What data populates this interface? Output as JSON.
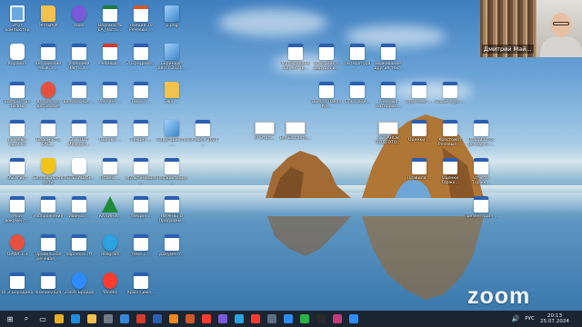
{
  "desktop_icons": [
    {
      "label": "Этот компьютер",
      "kind": "pc",
      "col": 0,
      "row": 0
    },
    {
      "label": "ЯРЛЫКИ",
      "kind": "folder",
      "col": 1,
      "row": 0
    },
    {
      "label": "Viber",
      "kind": "purple",
      "col": 2,
      "row": 0
    },
    {
      "label": "Ведомость ЕА_Часть...",
      "kind": "xls",
      "col": 3,
      "row": 0
    },
    {
      "label": "Лекция 10 Речевые ...",
      "kind": "ppt",
      "col": 4,
      "row": 0
    },
    {
      "label": "1.png",
      "kind": "img",
      "col": 5,
      "row": 0
    },
    {
      "label": "Корзина",
      "kind": "app",
      "col": 0,
      "row": 1
    },
    {
      "label": "английский язык 3 ...",
      "kind": "doc",
      "col": 1,
      "row": 1
    },
    {
      "label": "учебники Часть 3 ...",
      "kind": "doc",
      "col": 2,
      "row": 1
    },
    {
      "label": "Учебный ...",
      "kind": "pdf",
      "col": 3,
      "row": 1
    },
    {
      "label": "202pl-Дним...",
      "kind": "doc",
      "col": 4,
      "row": 1
    },
    {
      "label": "Скриншот 08.07.2024...",
      "kind": "img",
      "col": 5,
      "row": 1
    },
    {
      "label": "Восприятие письма",
      "kind": "doc",
      "col": 0,
      "row": 2
    },
    {
      "label": "депрессия депрессия",
      "kind": "red",
      "col": 1,
      "row": 2
    },
    {
      "label": "Визуальные ...",
      "kind": "doc",
      "col": 2,
      "row": 2
    },
    {
      "label": "Рейтинг ...",
      "kind": "doc",
      "col": 3,
      "row": 2
    },
    {
      "label": "Тема 2 ...",
      "kind": "doc",
      "col": 4,
      "row": 2
    },
    {
      "label": "Эко ...",
      "kind": "folder",
      "col": 5,
      "row": 2
    },
    {
      "label": "речевые ошибки",
      "kind": "doc",
      "col": 0,
      "row": 3
    },
    {
      "label": "Ведомость ЕАЕ_..",
      "kind": "doc",
      "col": 1,
      "row": 3
    },
    {
      "label": "ВС 2024 Информ...",
      "kind": "doc",
      "col": 2,
      "row": 3
    },
    {
      "label": "Оценки ...",
      "kind": "doc",
      "col": 3,
      "row": 3
    },
    {
      "label": "Лекция ...",
      "kind": "doc",
      "col": 4,
      "row": 3
    },
    {
      "label": "Навигация по ...",
      "kind": "img",
      "col": 5,
      "row": 3
    },
    {
      "label": "19 июля 2024 ...",
      "kind": "doc",
      "col": 6,
      "row": 3
    },
    {
      "label": "BSE-лист",
      "kind": "doc",
      "col": 0,
      "row": 4
    },
    {
      "label": "Безопасность сети",
      "kind": "shield",
      "col": 1,
      "row": 4
    },
    {
      "label": "РЕПЕТИЦИЯ...",
      "kind": "app",
      "col": 2,
      "row": 4
    },
    {
      "label": "Планы ...",
      "kind": "doc",
      "col": 3,
      "row": 4
    },
    {
      "label": "Мультимедиа ...",
      "kind": "doc",
      "col": 4,
      "row": 4
    },
    {
      "label": "Нафаризация ...",
      "kind": "doc",
      "col": 5,
      "row": 4
    },
    {
      "label": "Мой документ...",
      "kind": "doc",
      "col": 0,
      "row": 5
    },
    {
      "label": "изображения",
      "kind": "doc",
      "col": 1,
      "row": 5
    },
    {
      "label": "Иванов ...",
      "kind": "doc",
      "col": 2,
      "row": 5
    },
    {
      "label": "КАЛИНИ...",
      "kind": "tree",
      "col": 3,
      "row": 5
    },
    {
      "label": "Лекция ...",
      "kind": "doc",
      "col": 4,
      "row": 5
    },
    {
      "label": "НИЖНЕГО Программ...",
      "kind": "doc",
      "col": 5,
      "row": 5
    },
    {
      "label": "ОРФА 1-3",
      "kind": "red",
      "col": 0,
      "row": 6
    },
    {
      "label": "Правильная речевая ...",
      "kind": "doc",
      "col": 1,
      "row": 6
    },
    {
      "label": "sopheuss.rtf",
      "kind": "doc",
      "col": 2,
      "row": 6
    },
    {
      "label": "Telegram",
      "kind": "tg",
      "col": 3,
      "row": 6
    },
    {
      "label": "Тема 2 ...",
      "kind": "doc",
      "col": 4,
      "row": 6
    },
    {
      "label": "Документ...",
      "kind": "doc",
      "col": 5,
      "row": 6
    },
    {
      "label": "ОГЭ Бородина",
      "kind": "doc",
      "col": 0,
      "row": 7
    },
    {
      "label": "знание2024",
      "kind": "doc",
      "col": 1,
      "row": 7
    },
    {
      "label": "Zoom Бродов",
      "kind": "zoom",
      "col": 2,
      "row": 7
    },
    {
      "label": "Yandex",
      "kind": "ya",
      "col": 3,
      "row": 7
    },
    {
      "label": "Хрма Сима...",
      "kind": "doc",
      "col": 4,
      "row": 7
    },
    {
      "label": "Мутафудине директ ф...",
      "kind": "doc",
      "col": 9,
      "row": 1
    },
    {
      "label": "описание о дерудоли...",
      "kind": "doc",
      "col": 10,
      "row": 1
    },
    {
      "label": "Литература",
      "kind": "doc",
      "col": 11,
      "row": 1
    },
    {
      "label": "Выживание другие тек...",
      "kind": "doc",
      "col": 12,
      "row": 1
    },
    {
      "label": "Школа Павла Ко...",
      "kind": "doc",
      "col": 10,
      "row": 2
    },
    {
      "label": "Ольховой...",
      "kind": "doc",
      "col": 11,
      "row": 2
    },
    {
      "label": "Учебный материал...",
      "kind": "doc",
      "col": 12,
      "row": 2
    },
    {
      "label": "Фрагмент ...",
      "kind": "doc",
      "col": 13,
      "row": 2
    },
    {
      "label": "Пасхи курс ...",
      "kind": "doc",
      "col": 14,
      "row": 2
    },
    {
      "label": "IV Этап...",
      "kind": "slide",
      "col": 8,
      "row": 3
    },
    {
      "label": "ВМ Бюллете...",
      "kind": "slide",
      "col": 9,
      "row": 3
    },
    {
      "label": "5 ЭТАПОВ ПОДГОТО...",
      "kind": "slide",
      "col": 12,
      "row": 3
    },
    {
      "label": "Оценки ...",
      "kind": "doc",
      "col": 13,
      "row": 3
    },
    {
      "label": "Хрестомат Речевые ...",
      "kind": "doc",
      "col": 14,
      "row": 3
    },
    {
      "label": "Разработка речевого ...",
      "kind": "doc",
      "col": 15,
      "row": 3
    },
    {
      "label": "Правила ...",
      "kind": "doc",
      "col": 13,
      "row": 4
    },
    {
      "label": "Оценки Торжк...",
      "kind": "doc",
      "col": 14,
      "row": 4
    },
    {
      "label": "Отчеты Торжк...",
      "kind": "doc",
      "col": 15,
      "row": 4
    },
    {
      "label": "Презентация ...",
      "kind": "doc",
      "col": 15,
      "row": 5
    }
  ],
  "webcam": {
    "participant_name": "Дмитрий Май..."
  },
  "zoom_watermark": {
    "text": "zoom"
  },
  "taskbar": {
    "items": [
      {
        "name": "start-button",
        "glyph": "⊞",
        "color": "#ffffff"
      },
      {
        "name": "search-icon",
        "glyph": "⌕",
        "color": "#ffffff"
      },
      {
        "name": "task-view-icon",
        "glyph": "▭",
        "color": "#ffffff"
      },
      {
        "name": "chrome-icon",
        "glyph": "",
        "color": "#e8b02a"
      },
      {
        "name": "edge-icon",
        "glyph": "",
        "color": "#1e8de0"
      },
      {
        "name": "explorer-icon",
        "glyph": "",
        "color": "#f2c14e"
      },
      {
        "name": "calculator-icon",
        "glyph": "",
        "color": "#707a86"
      },
      {
        "name": "store-icon",
        "glyph": "",
        "color": "#3a86d6"
      },
      {
        "name": "app-icon",
        "glyph": "",
        "color": "#d23b2f"
      },
      {
        "name": "word-icon",
        "glyph": "",
        "color": "#2b5fb0"
      },
      {
        "name": "vlc-icon",
        "glyph": "",
        "color": "#f08a1d"
      },
      {
        "name": "powerpoint-icon",
        "glyph": "",
        "color": "#d2582c"
      },
      {
        "name": "yandex-icon",
        "glyph": "",
        "color": "#ff3b2f"
      },
      {
        "name": "app-icon-2",
        "glyph": "",
        "color": "#7a5ad8"
      },
      {
        "name": "telegram-icon",
        "glyph": "",
        "color": "#2aa3e0"
      },
      {
        "name": "yandex-browser-icon",
        "glyph": "",
        "color": "#ff3b2f"
      },
      {
        "name": "app-icon-3",
        "glyph": "",
        "color": "#5d6f86"
      },
      {
        "name": "app-icon-4",
        "glyph": "",
        "color": "#2d8cf0"
      },
      {
        "name": "whatsapp-icon",
        "glyph": "",
        "color": "#2bb34a"
      },
      {
        "name": "app-icon-5",
        "glyph": "",
        "color": "#2a2a2a"
      },
      {
        "name": "app-icon-6",
        "glyph": "",
        "color": "#c23b7a"
      },
      {
        "name": "zoom-icon",
        "glyph": "",
        "color": "#2d8cff"
      }
    ]
  },
  "tray": {
    "language": "РУС",
    "time": "20:13",
    "date": "25.07.2024"
  }
}
